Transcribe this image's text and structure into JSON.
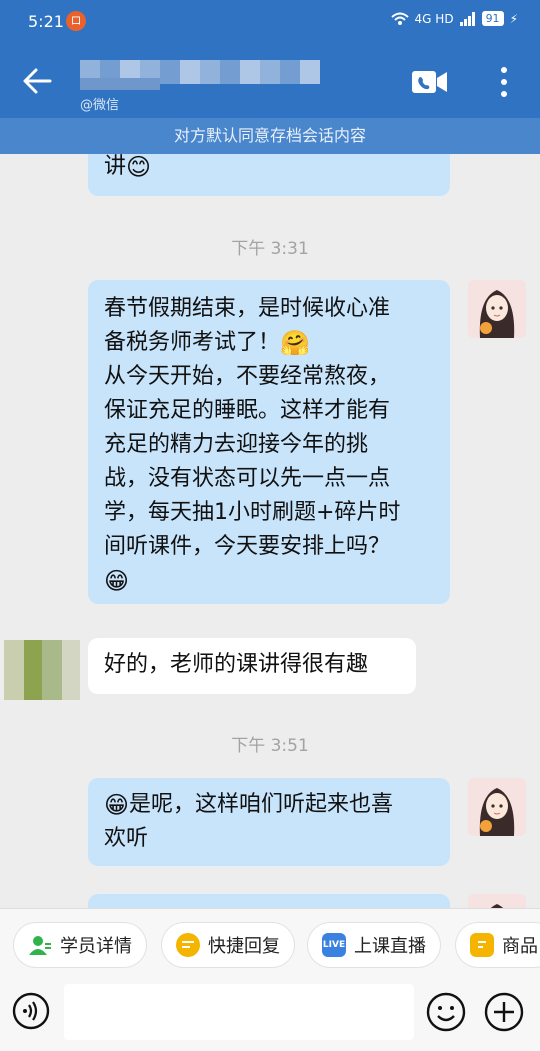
{
  "status_bar": {
    "time": "5:21",
    "notif_glyph": "ロ",
    "network": "4G HD",
    "battery": "91"
  },
  "header": {
    "subtitle": "@微信",
    "notice": "对方默认同意存档会话内容"
  },
  "messages": [
    {
      "side": "right",
      "text": "讲",
      "emoji": "smile"
    },
    {
      "time": "下午 3:31"
    },
    {
      "side": "right",
      "lines": [
        "春节假期结束，是时候收心准",
        "备税务师考试了！",
        "从今天开始，不要经常熬夜，",
        "保证充足的睡眠。这样才能有",
        "充足的精力去迎接今年的挑",
        "战，没有状态可以先一点一点",
        "学，每天抽1小时刷题+碎片时",
        "间听课件，今天要安排上吗？"
      ]
    },
    {
      "side": "left",
      "text": "好的，老师的课讲得很有趣"
    },
    {
      "time": "下午 3:51"
    },
    {
      "side": "right",
      "lines": [
        "是呢，这样咱们听起来也喜",
        "欢听"
      ]
    }
  ],
  "quick_actions": [
    {
      "label": "学员详情",
      "icon": "user-icon",
      "color": "#2fb34a"
    },
    {
      "label": "快捷回复",
      "icon": "reply-icon",
      "color": "#f4b400"
    },
    {
      "label": "上课直播",
      "icon": "live-icon",
      "color": "#3b82e0",
      "badge": "LIVE"
    },
    {
      "label": "商品",
      "icon": "product-icon",
      "color": "#f4b400"
    }
  ],
  "colors": {
    "header": "#2f73c2",
    "bubble_self": "#c8e4fb",
    "bubble_other": "#ffffff"
  }
}
